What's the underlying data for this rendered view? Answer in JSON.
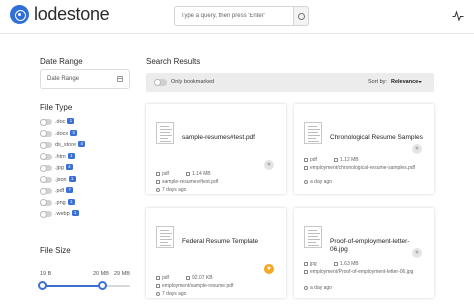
{
  "app": {
    "name": "lodestone"
  },
  "search": {
    "placeholder": "Type a query, then press 'Enter'",
    "value": ""
  },
  "sidebar": {
    "date_range": {
      "title": "Date Range",
      "input_label": "Date Range"
    },
    "file_type": {
      "title": "File Type",
      "items": [
        {
          "label": ".doc",
          "count": "1"
        },
        {
          "label": ".docx",
          "count": "3"
        },
        {
          "label": "ds_store",
          "count": "4"
        },
        {
          "label": ".htm",
          "count": "1"
        },
        {
          "label": ".jpg",
          "count": "4"
        },
        {
          "label": ".json",
          "count": "1"
        },
        {
          "label": ".pdf",
          "count": "7"
        },
        {
          "label": ".png",
          "count": "1"
        },
        {
          "label": ".webp",
          "count": "1"
        }
      ]
    },
    "file_size": {
      "title": "File Size",
      "min_label": "19 B",
      "mid_label": "20 MB",
      "max_label": "29 MB",
      "min": "19 B",
      "selected_max_fraction": 0.69,
      "max": "29 MB"
    }
  },
  "results": {
    "title": "Search Results",
    "bookmark_filter_label": "Only bookmarked",
    "sort_label": "Sort by:",
    "sort_value": "Relevance",
    "cards": [
      {
        "title": "sample-resumes#test.pdf",
        "type": "pdf",
        "size": "1.14 MB",
        "path": "sample-resumes#test.pdf",
        "time": "7 days ago",
        "bookmarked": false
      },
      {
        "title": "Chronological Resume Samples",
        "type": "pdf",
        "size": "1.12 MB",
        "path": "employment/chronological-resume-samples.pdf",
        "time": "a day ago",
        "bookmarked": false
      },
      {
        "title": "Federal Resume Template",
        "type": "pdf",
        "size": "92.07 KB",
        "path": "employment/sample-resume.pdf",
        "time": "7 days ago",
        "bookmarked": true
      },
      {
        "title": "Proof-of-employment-letter-06.jpg",
        "type": "jpg",
        "size": "1.63 MB",
        "path": "employment/Proof-of-employment-letter-06.jpg",
        "time": "a day ago",
        "bookmarked": false
      }
    ]
  },
  "colors": {
    "accent": "#3a6fd8",
    "star_active": "#f5a623",
    "logo": "#2f6fd6"
  },
  "icons": {
    "logo": "compass-logo-icon",
    "search_button": "search-icon",
    "activity": "activity-icon",
    "calendar": "calendar-icon",
    "star": "star-icon"
  }
}
